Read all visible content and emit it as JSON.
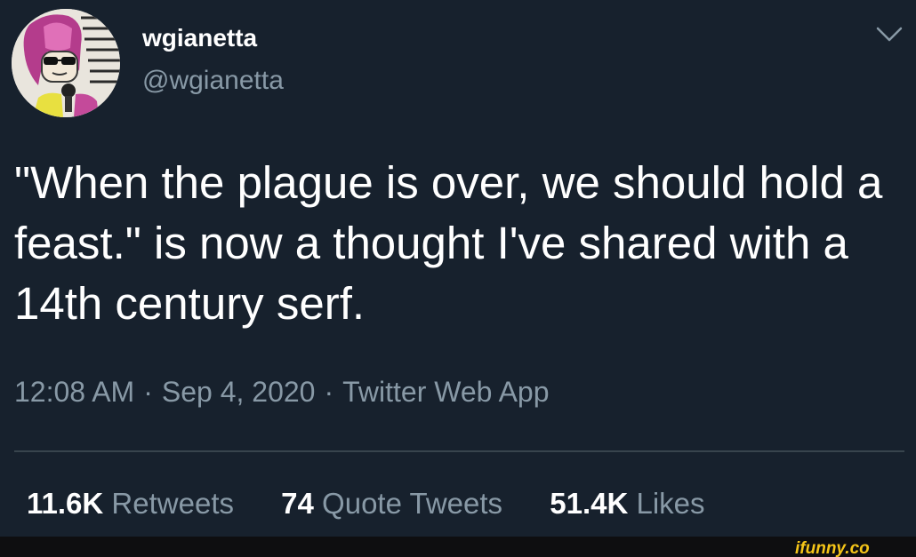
{
  "user": {
    "display_name": "wgianetta",
    "handle": "@wgianetta"
  },
  "tweet": {
    "text": "\"When the plague is over, we should hold a feast.\" is now a thought I've shared with a 14th century serf.",
    "time": "12:08 AM",
    "date": "Sep 4, 2020",
    "source": "Twitter Web App",
    "separator": "·"
  },
  "stats": [
    {
      "count": "11.6K",
      "label": "Retweets"
    },
    {
      "count": "74",
      "label": "Quote Tweets"
    },
    {
      "count": "51.4K",
      "label": "Likes"
    }
  ],
  "watermark": {
    "text": "ifunny.co"
  },
  "icons": {
    "menu": "chevron-down-icon",
    "avatar": "avatar-image"
  },
  "colors": {
    "background": "#17212d",
    "primary_text": "#ffffff",
    "secondary_text": "#8899a6",
    "divider": "#38444d",
    "watermark": "#f5c518"
  }
}
